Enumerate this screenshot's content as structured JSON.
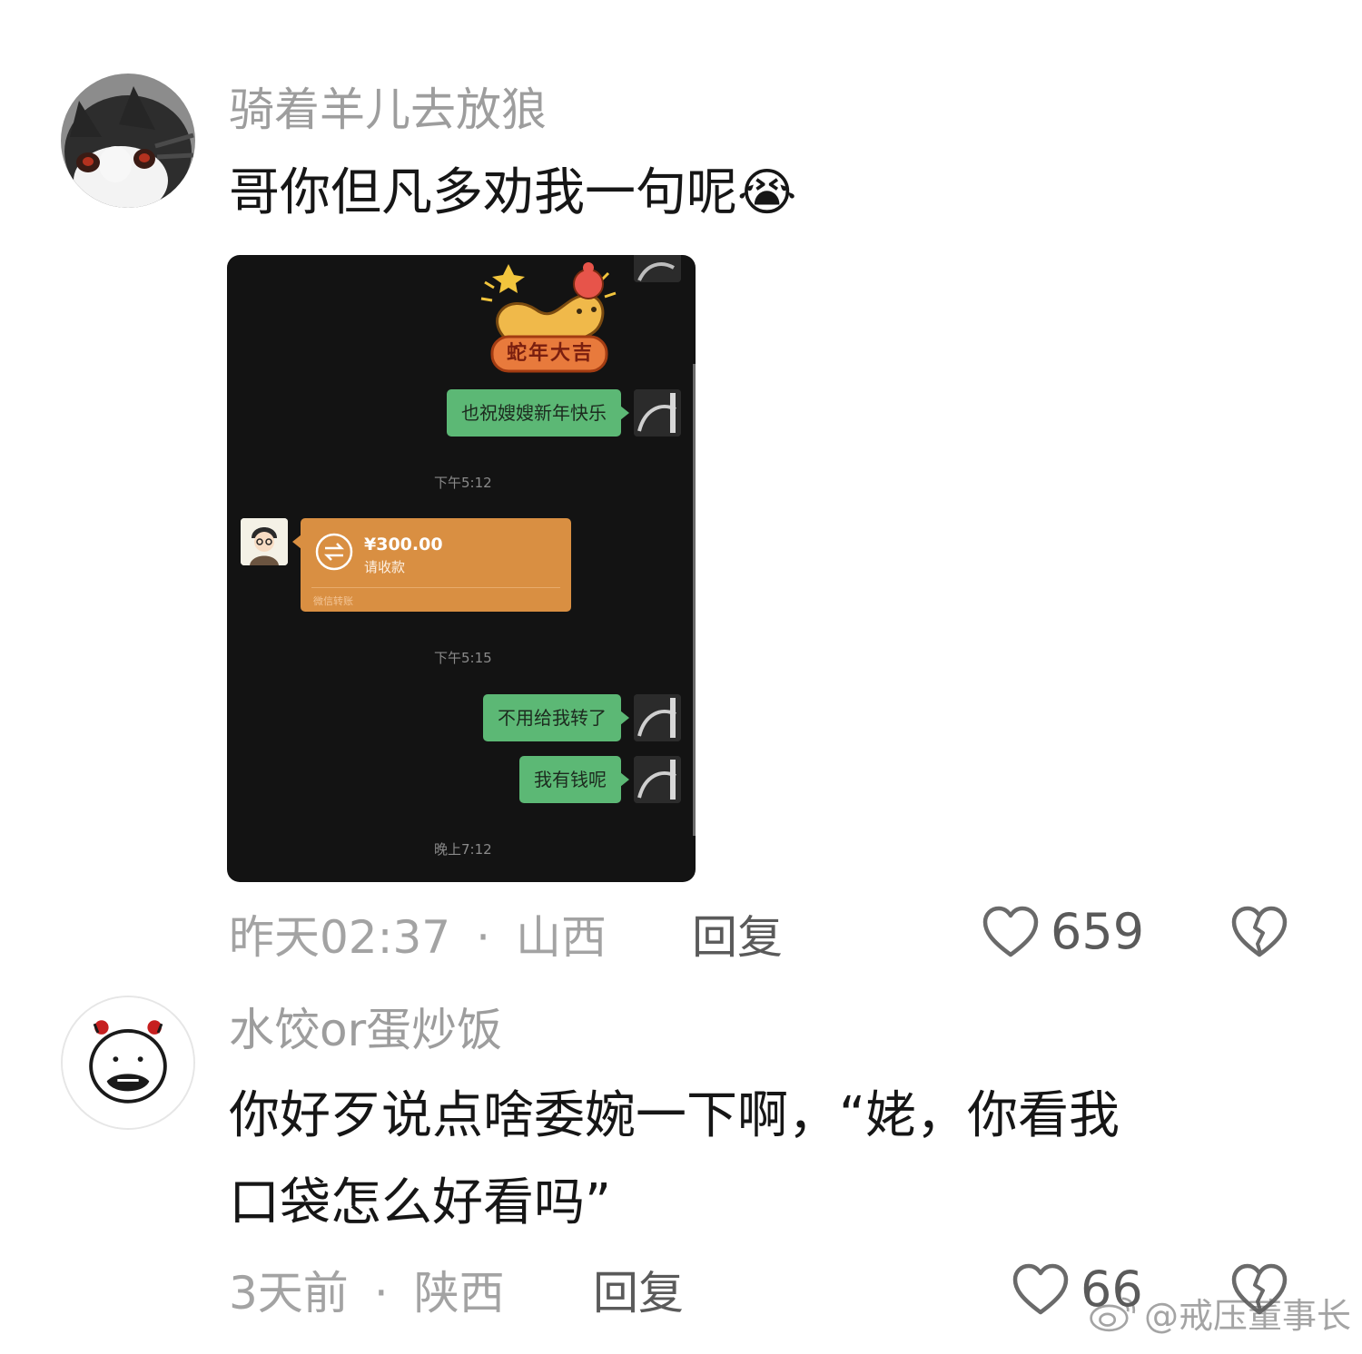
{
  "comments": [
    {
      "username": "骑着羊儿去放狼",
      "text_lines": [
        "哥你但凡多劝我一句呢😭"
      ],
      "time": "昨天02:37",
      "separator": "·",
      "location": "山西",
      "reply_label": "回复",
      "like_count": "659"
    },
    {
      "username": "水饺or蛋炒饭",
      "text_lines": [
        "你好歹说点啥委婉一下啊，“姥，你看我",
        "口袋怎么好看吗”"
      ],
      "time": "3天前",
      "separator": "·",
      "location": "陕西",
      "reply_label": "回复",
      "like_count": "66"
    }
  ],
  "attached_screenshot": {
    "sticker_text": "蛇年大吉",
    "messages": [
      {
        "type": "sent",
        "text": "也祝嫂嫂新年快乐"
      },
      {
        "type": "time",
        "text": "下午5:12"
      },
      {
        "type": "transfer",
        "amount": "¥300.00",
        "subtitle": "请收款",
        "footer": "微信转账"
      },
      {
        "type": "time",
        "text": "下午5:15"
      },
      {
        "type": "sent",
        "text": "不用给我转了"
      },
      {
        "type": "sent",
        "text": "我有钱呢"
      },
      {
        "type": "time",
        "text": "晚上7:12"
      }
    ]
  },
  "watermark": "@戒压董事长",
  "icons": {
    "like": "heart-icon",
    "dislike": "broken-heart-icon",
    "watermark": "weibo-icon",
    "emoji": "loudly-crying-face-emoji"
  },
  "colors": {
    "username": "#9d9d9d",
    "bubble_green": "#5cb875",
    "transfer_orange": "#d98f42",
    "chat_bg": "#131313"
  }
}
